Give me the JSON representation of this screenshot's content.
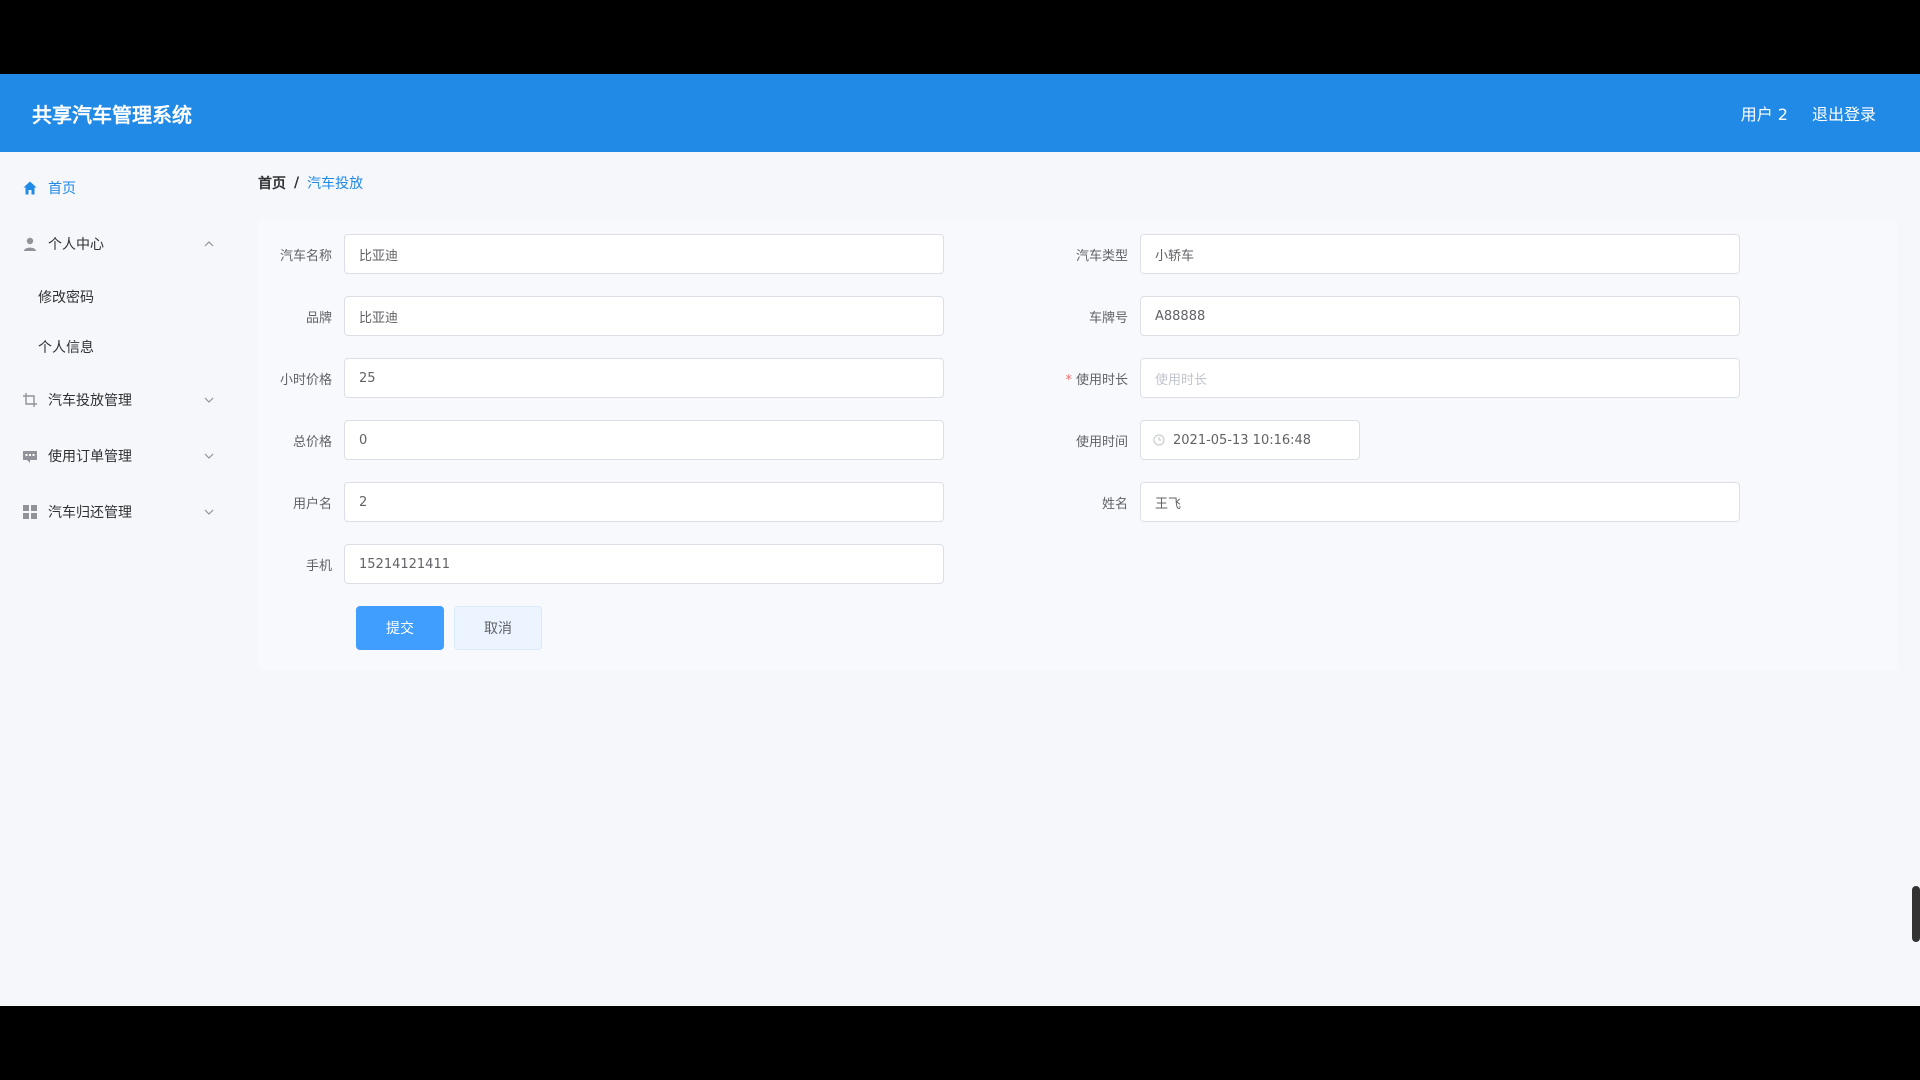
{
  "header": {
    "title": "共享汽车管理系统",
    "user_label": "用户 2",
    "logout_label": "退出登录"
  },
  "sidebar": {
    "items": [
      {
        "label": "首页",
        "icon": "home-icon",
        "active": true
      },
      {
        "label": "个人中心",
        "icon": "user-icon",
        "expanded": true,
        "children": [
          {
            "label": "修改密码"
          },
          {
            "label": "个人信息"
          }
        ]
      },
      {
        "label": "汽车投放管理",
        "icon": "crop-icon"
      },
      {
        "label": "使用订单管理",
        "icon": "message-icon"
      },
      {
        "label": "汽车归还管理",
        "icon": "grid-icon"
      }
    ]
  },
  "breadcrumb": {
    "home": "首页",
    "separator": "/",
    "current": "汽车投放"
  },
  "form": {
    "car_name": {
      "label": "汽车名称",
      "value": "比亚迪"
    },
    "car_type": {
      "label": "汽车类型",
      "value": "小轿车"
    },
    "brand": {
      "label": "品牌",
      "value": "比亚迪"
    },
    "plate": {
      "label": "车牌号",
      "value": "A88888"
    },
    "hourly_price": {
      "label": "小时价格",
      "value": "25"
    },
    "duration": {
      "label": "使用时长",
      "value": "",
      "placeholder": "使用时长",
      "required": true
    },
    "total_price": {
      "label": "总价格",
      "value": "0"
    },
    "use_time": {
      "label": "使用时间",
      "value": "2021-05-13 10:16:48"
    },
    "username": {
      "label": "用户名",
      "value": "2"
    },
    "name": {
      "label": "姓名",
      "value": "王飞"
    },
    "phone": {
      "label": "手机",
      "value": "15214121411"
    },
    "submit_label": "提交",
    "cancel_label": "取消"
  },
  "colors": {
    "primary": "#2189e6",
    "button_primary": "#409eff",
    "required": "#f56c6c"
  }
}
